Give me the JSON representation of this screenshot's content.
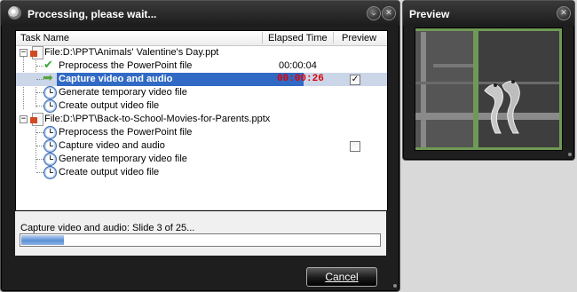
{
  "main_window": {
    "title": "Processing, please wait...",
    "buttons": {
      "minimize": "⌄",
      "close": "✕"
    }
  },
  "preview_window": {
    "title": "Preview",
    "buttons": {
      "close": "✕"
    }
  },
  "table": {
    "columns": [
      "Task Name",
      "Elapsed Time",
      "Preview"
    ],
    "rows": [
      {
        "label": "File:D:\\PPT\\Animals' Valentine's Day.ppt",
        "time": "",
        "type": "file"
      },
      {
        "label": "Preprocess the PowerPoint file",
        "time": "00:00:04",
        "type": "done"
      },
      {
        "label": "Capture video and audio",
        "time": "00:00:26",
        "type": "active",
        "preview_checked": "✓"
      },
      {
        "label": "Generate temporary video file",
        "time": "",
        "type": "pending"
      },
      {
        "label": "Create output video file",
        "time": "",
        "type": "pending"
      },
      {
        "label": "File:D:\\PPT\\Back-to-School-Movies-for-Parents.pptx",
        "time": "",
        "type": "file"
      },
      {
        "label": "Preprocess the PowerPoint file",
        "time": "",
        "type": "pending"
      },
      {
        "label": "Capture video and audio",
        "time": "",
        "type": "pending",
        "preview_checked": ""
      },
      {
        "label": "Generate temporary video file",
        "time": "",
        "type": "pending"
      },
      {
        "label": "Create output video file",
        "time": "",
        "type": "pending"
      }
    ]
  },
  "status": {
    "text": "Capture video and audio: Slide 3 of 25...",
    "progress": 0.12
  },
  "cancel_label": "Cancel",
  "colors": {
    "selection": "#316ac5",
    "active_time": "#e00000",
    "preview_border": "#6f9a55"
  }
}
